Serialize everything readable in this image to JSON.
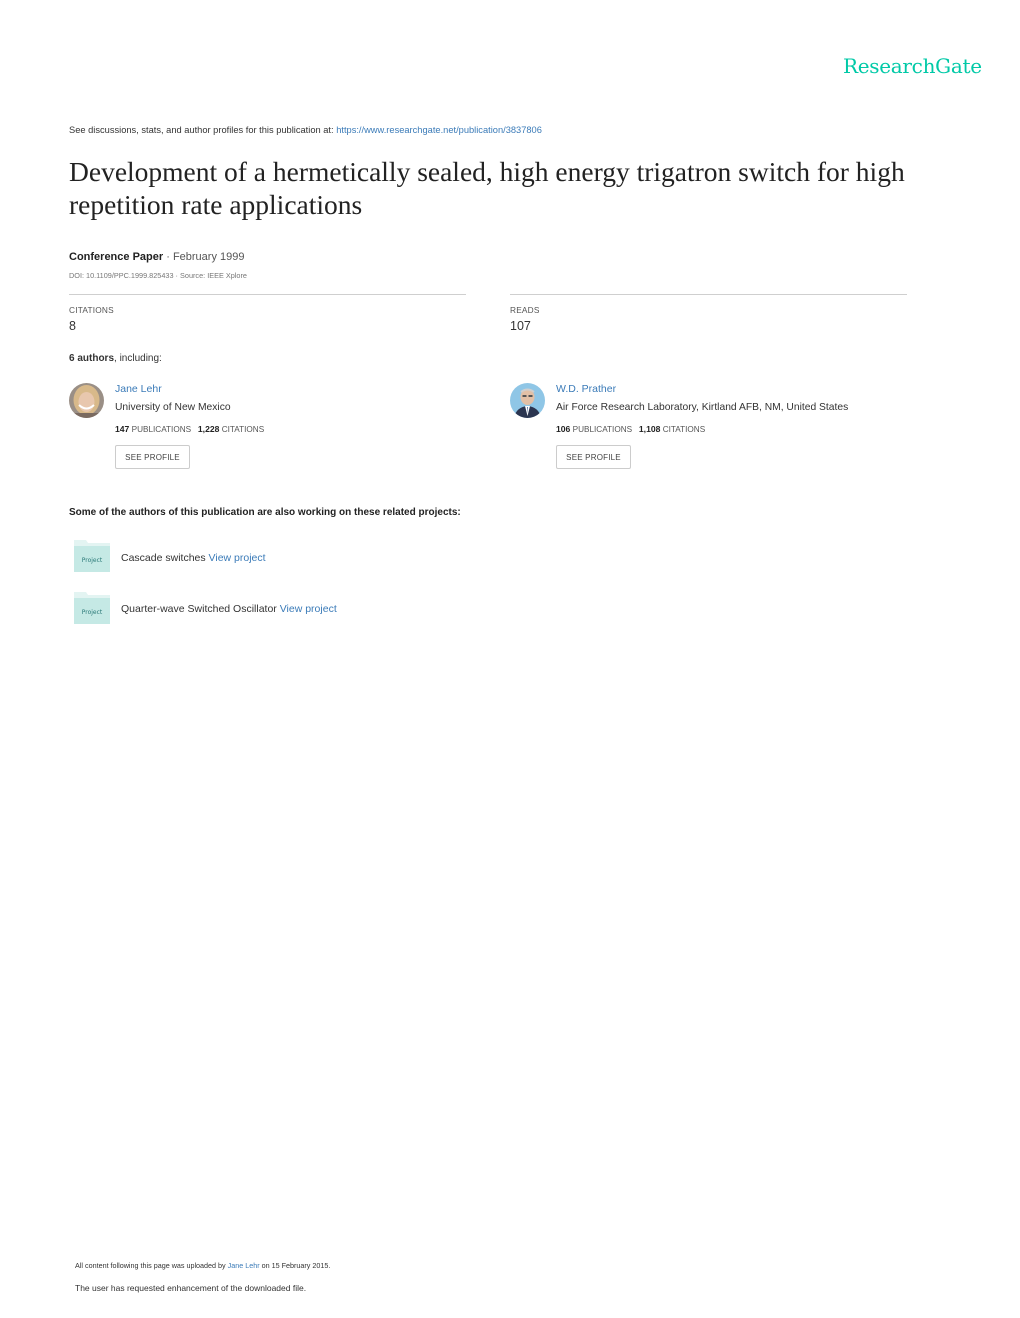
{
  "brand": {
    "name": "ResearchGate",
    "color": "#00c9a7"
  },
  "intro": {
    "text": "See discussions, stats, and author profiles for this publication at: ",
    "url": "https://www.researchgate.net/publication/3837806"
  },
  "publication": {
    "title": "Development of a hermetically sealed, high energy trigatron switch for high repetition rate applications",
    "type": "Conference Paper",
    "date_sep": " · ",
    "date": "February 1999",
    "doi_line": "DOI: 10.1109/PPC.1999.825433 · Source: IEEE Xplore"
  },
  "stats": {
    "citations": {
      "label": "CITATIONS",
      "value": "8"
    },
    "reads": {
      "label": "READS",
      "value": "107"
    }
  },
  "authors": {
    "count_bold": "6 authors",
    "count_rest": ", including:",
    "list": [
      {
        "name": "Jane Lehr",
        "affiliation": "University of New Mexico",
        "publications": "147",
        "publications_label": "PUBLICATIONS",
        "citations": "1,228",
        "citations_label": "CITATIONS",
        "button": "SEE PROFILE"
      },
      {
        "name": "W.D. Prather",
        "affiliation": "Air Force Research Laboratory, Kirtland AFB, NM, United States",
        "publications": "106",
        "publications_label": "PUBLICATIONS",
        "citations": "1,108",
        "citations_label": "CITATIONS",
        "button": "SEE PROFILE"
      }
    ]
  },
  "related": {
    "heading": "Some of the authors of this publication are also working on these related projects:",
    "projects": [
      {
        "icon_label": "Project",
        "name": "Cascade switches ",
        "link": "View project"
      },
      {
        "icon_label": "Project",
        "name": "Quarter-wave Switched Oscillator ",
        "link": "View project"
      }
    ]
  },
  "footer": {
    "upload_prefix": "All content following this page was uploaded by ",
    "upload_user": "Jane Lehr",
    "upload_suffix": " on 15 February 2015.",
    "enhancement": "The user has requested enhancement of the downloaded file."
  }
}
